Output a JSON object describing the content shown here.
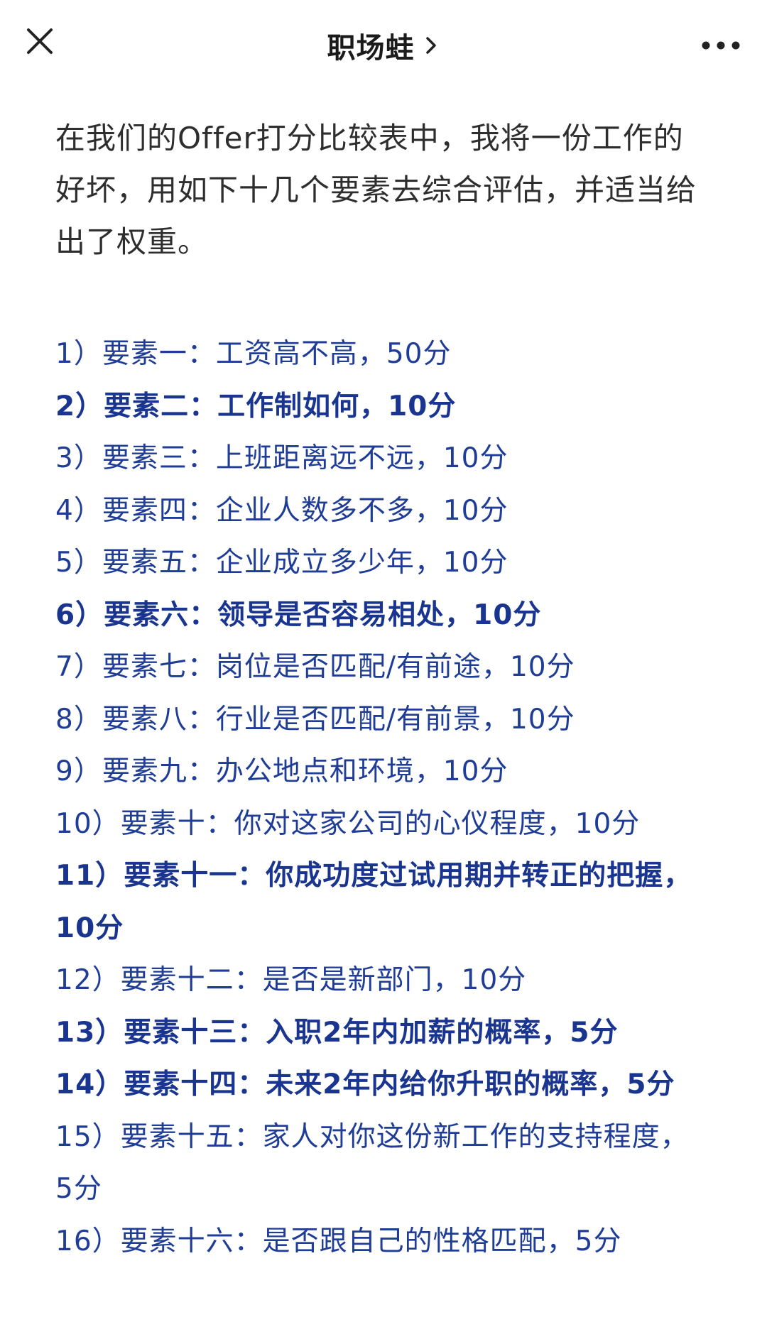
{
  "header": {
    "title": "职场蛙",
    "close_icon": "close-icon",
    "chevron_icon": "chevron-right-icon",
    "more_icon": "more-dots-icon"
  },
  "article": {
    "intro": "在我们的Offer打分比较表中，我将一份工作的好坏，用如下十几个要素去综合评估，并适当给出了权重。",
    "items": [
      {
        "text": "1）要素一：工资高不高，50分",
        "bold": false
      },
      {
        "text": "2）要素二：工作制如何，10分",
        "bold": true
      },
      {
        "text": "3）要素三：上班距离远不远，10分",
        "bold": false
      },
      {
        "text": "4）要素四：企业人数多不多，10分",
        "bold": false
      },
      {
        "text": "5）要素五：企业成立多少年，10分",
        "bold": false
      },
      {
        "text": "6）要素六：领导是否容易相处，10分",
        "bold": true
      },
      {
        "text": "7）要素七：岗位是否匹配/有前途，10分",
        "bold": false
      },
      {
        "text": "8）要素八：行业是否匹配/有前景，10分",
        "bold": false
      },
      {
        "text": "9）要素九：办公地点和环境，10分",
        "bold": false
      },
      {
        "text": "10）要素十：你对这家公司的心仪程度，10分",
        "bold": false
      },
      {
        "text": "11）要素十一：你成功度过试用期并转正的把握，10分",
        "bold": true
      },
      {
        "text": "12）要素十二：是否是新部门，10分",
        "bold": false
      },
      {
        "text": "13）要素十三：入职2年内加薪的概率，5分",
        "bold": true
      },
      {
        "text": "14）要素十四：未来2年内给你升职的概率，5分",
        "bold": true
      },
      {
        "text": "15）要素十五：家人对你这份新工作的支持程度，5分",
        "bold": false
      },
      {
        "text": "16）要素十六：是否跟自己的性格匹配，5分",
        "bold": false
      }
    ]
  },
  "colors": {
    "list_text": "#1f3d96",
    "intro_text": "#2e2e2e",
    "background": "#ffffff"
  }
}
